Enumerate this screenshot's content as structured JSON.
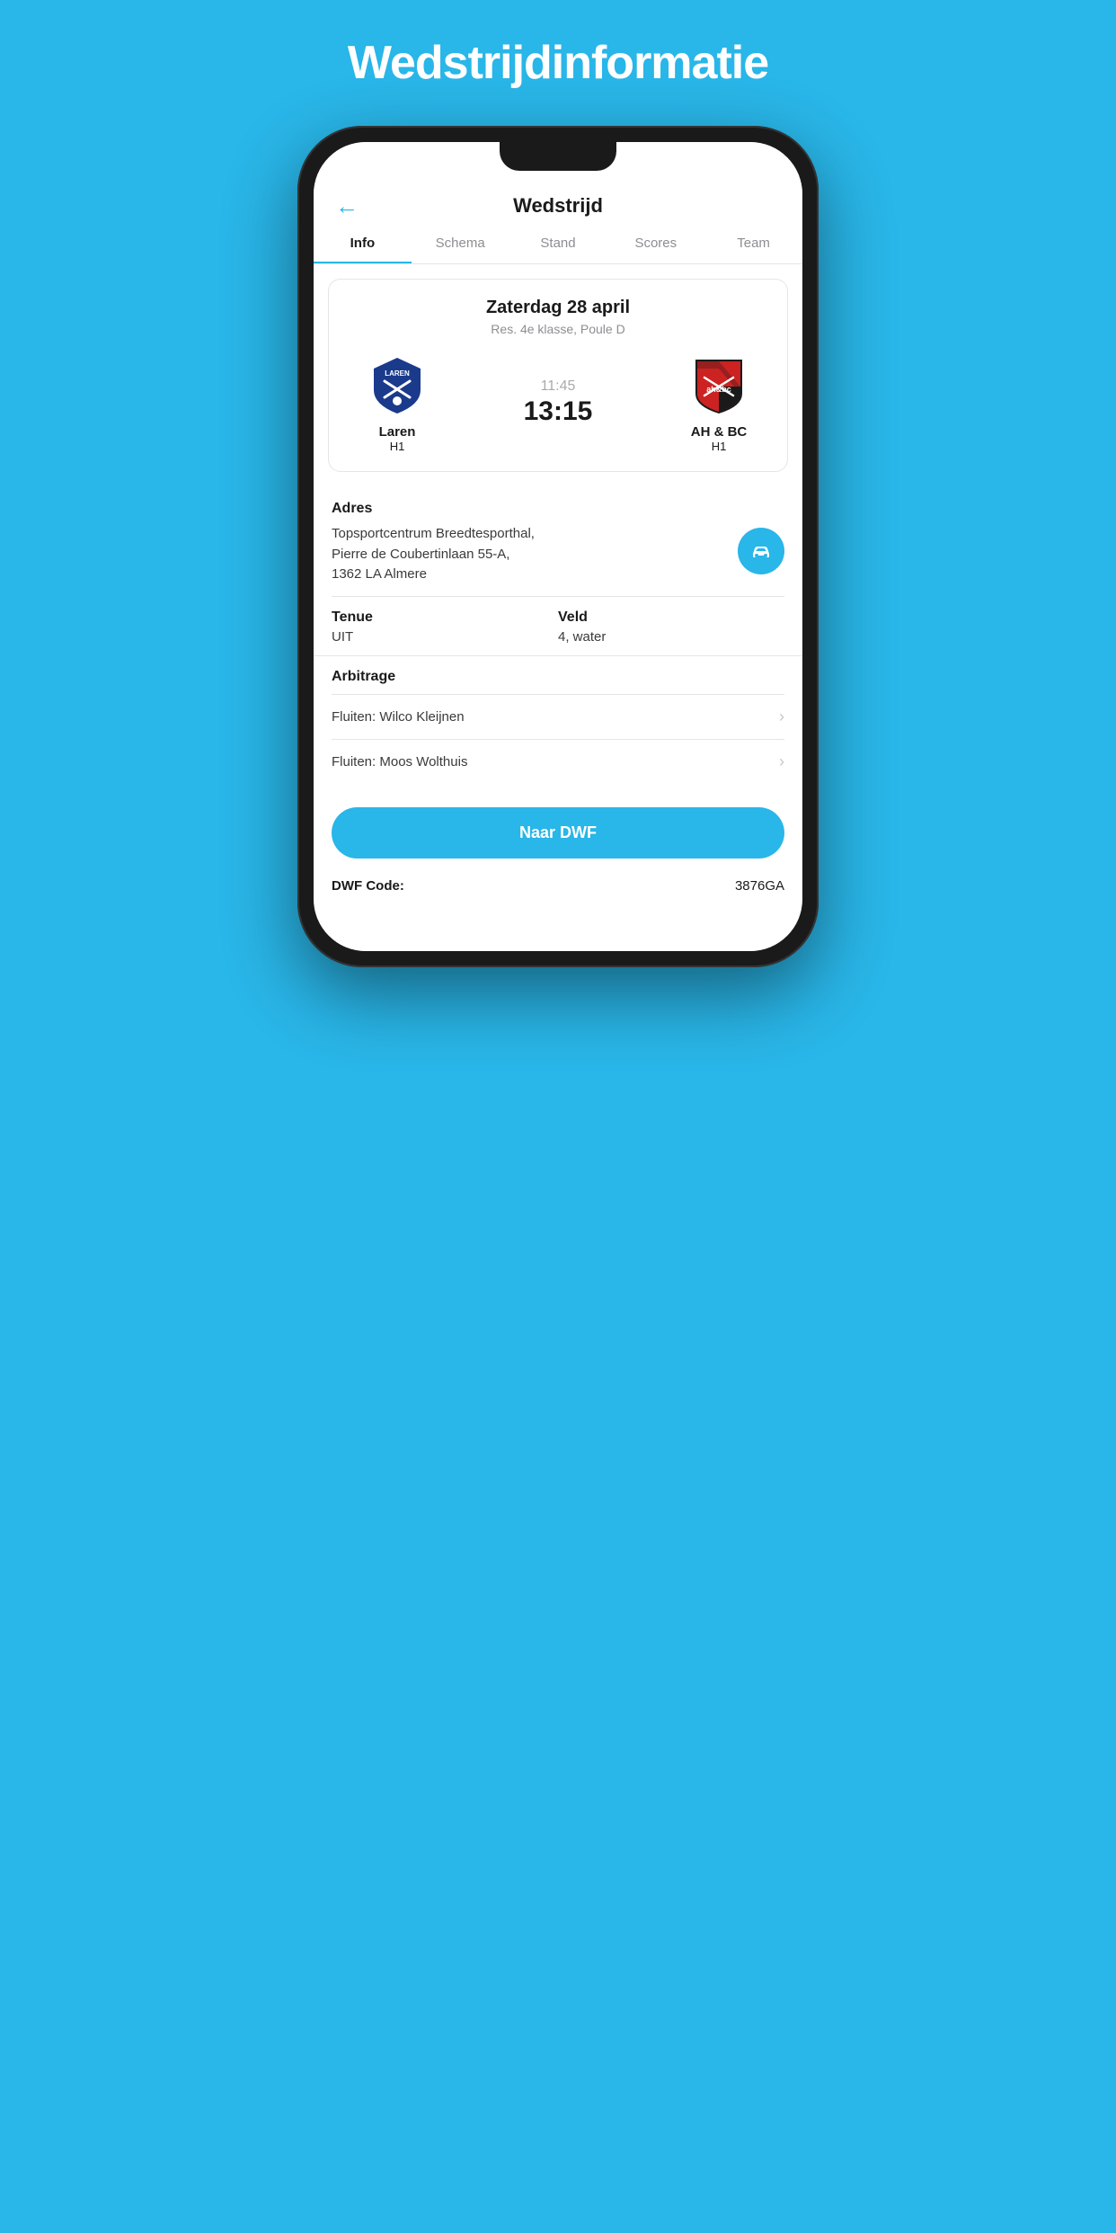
{
  "page": {
    "background_title": "Wedstrijdinformatie"
  },
  "header": {
    "back_icon": "←",
    "title": "Wedstrijd"
  },
  "tabs": [
    {
      "label": "Info",
      "active": true
    },
    {
      "label": "Schema",
      "active": false
    },
    {
      "label": "Stand",
      "active": false
    },
    {
      "label": "Scores",
      "active": false
    },
    {
      "label": "Team",
      "active": false
    }
  ],
  "match": {
    "date": "Zaterdag 28 april",
    "league": "Res. 4e klasse, Poule D",
    "time_prev": "11:45",
    "time_main": "13:15",
    "home_team": {
      "name": "Laren",
      "sub": "H1"
    },
    "away_team": {
      "name": "AH & BC",
      "sub": "H1"
    }
  },
  "info": {
    "address_label": "Adres",
    "address_text_line1": "Topsportcentrum Breedtesporthal,",
    "address_text_line2": "Pierre de Coubertinlaan 55-A,",
    "address_text_line3": "1362 LA Almere",
    "nav_icon": "🚗",
    "tenue_label": "Tenue",
    "tenue_value": "UIT",
    "veld_label": "Veld",
    "veld_value": "4, water",
    "arbitrage_label": "Arbitrage",
    "referees": [
      {
        "text": "Fluiten: Wilco Kleijnen"
      },
      {
        "text": "Fluiten: Moos Wolthuis"
      }
    ],
    "dwf_button_label": "Naar DWF",
    "dwf_code_label": "DWF Code:",
    "dwf_code_value": "3876GA"
  },
  "colors": {
    "accent": "#29b6e8",
    "text_primary": "#1a1a1a",
    "text_secondary": "#8e8e93",
    "border": "#e5e5ea"
  }
}
